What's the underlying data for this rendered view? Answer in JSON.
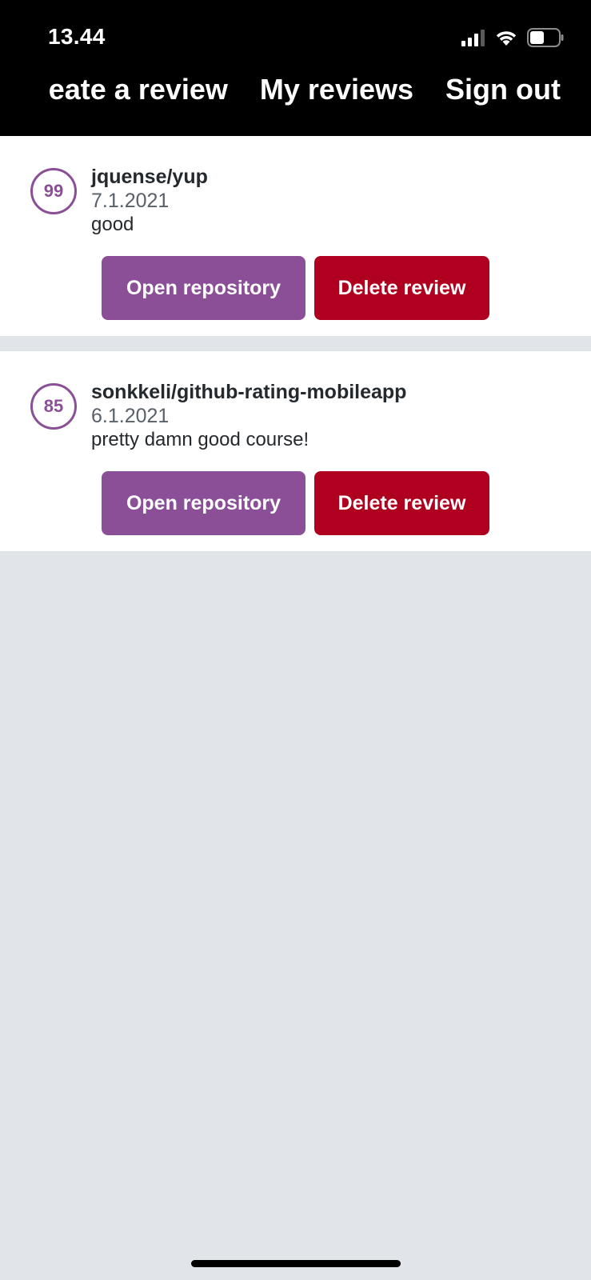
{
  "status_bar": {
    "time": "13.44",
    "icons": [
      "signal-icon",
      "wifi-icon",
      "battery-icon"
    ]
  },
  "app_bar": {
    "tabs": [
      {
        "label": "eate a review"
      },
      {
        "label": "My reviews"
      },
      {
        "label": "Sign out"
      }
    ]
  },
  "reviews": [
    {
      "rating": "99",
      "repository": "jquense/yup",
      "date": "7.1.2021",
      "text": "good",
      "open_label": "Open repository",
      "delete_label": "Delete review"
    },
    {
      "rating": "85",
      "repository": "sonkkeli/github-rating-mobileapp",
      "date": "6.1.2021",
      "text": "pretty damn good course!",
      "open_label": "Open repository",
      "delete_label": "Delete review"
    }
  ],
  "colors": {
    "app_bar": "#000000",
    "primary": "#8a4f96",
    "danger": "#b00020",
    "background": "#e1e4e8"
  }
}
